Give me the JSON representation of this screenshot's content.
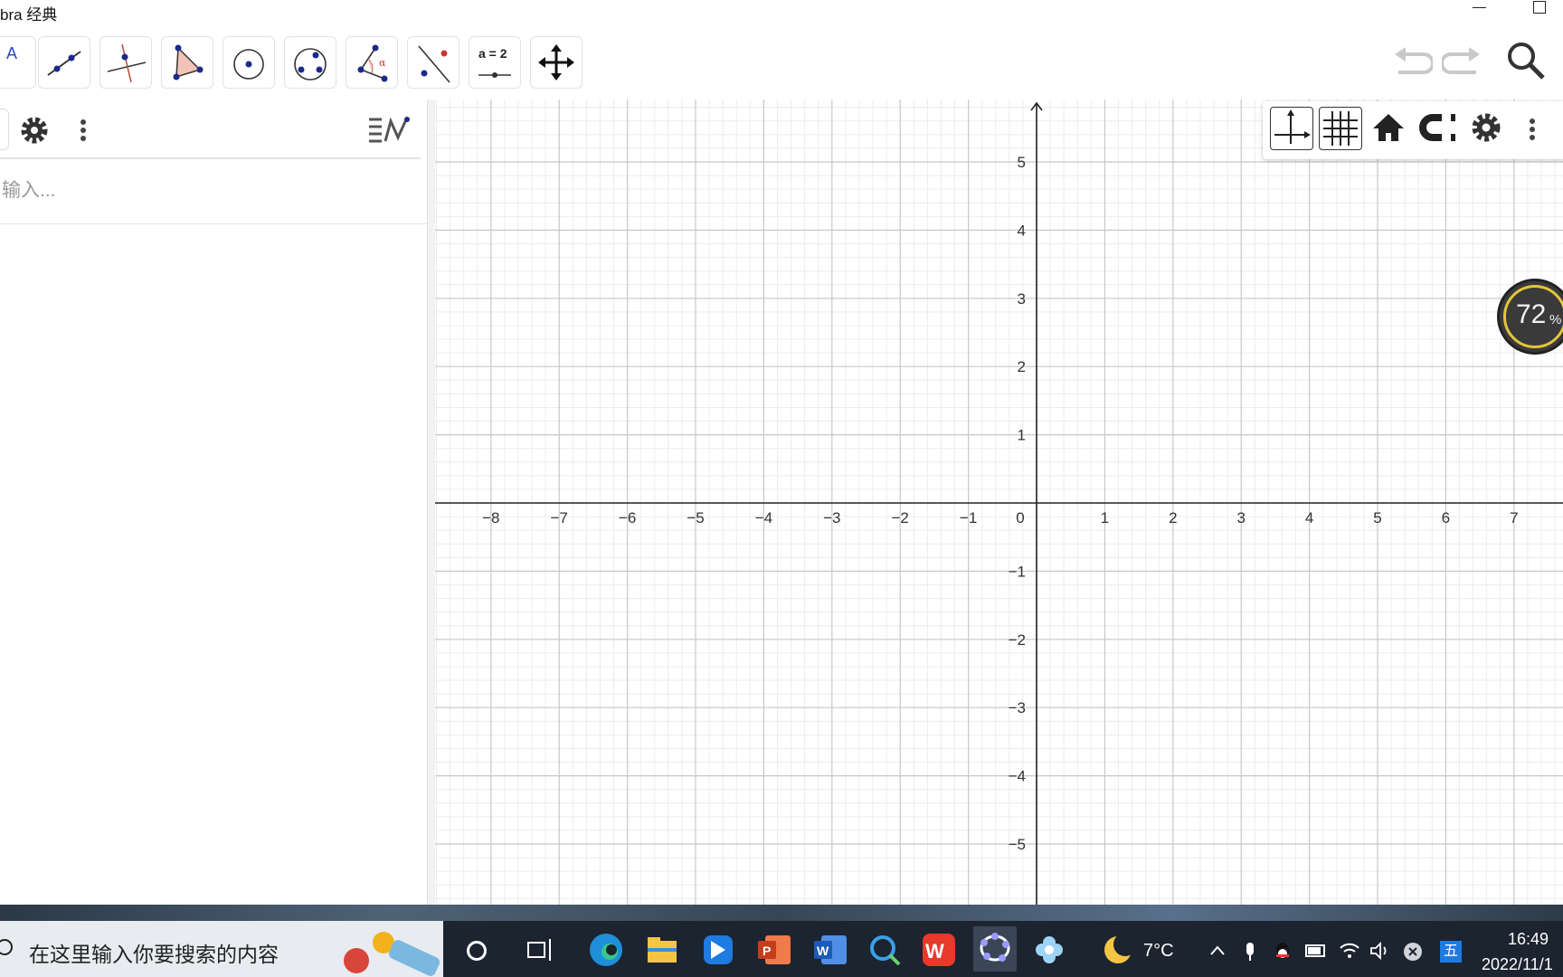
{
  "window": {
    "title": "bra 经典"
  },
  "toolbar": {
    "tools": [
      "move-tool",
      "point-tool",
      "line-tool",
      "perpendicular-tool",
      "polygon-tool",
      "circle-tool",
      "conic-tool",
      "angle-tool",
      "reflect-tool",
      "slider-tool",
      "move-graphics-tool"
    ],
    "slider_label": "a = 2",
    "text_tool_label": "A"
  },
  "algebra": {
    "input_placeholder": "输入..."
  },
  "graphics": {
    "x_ticks": [
      "−8",
      "−7",
      "−6",
      "−5",
      "−4",
      "−3",
      "−2",
      "−1",
      "0",
      "1",
      "2",
      "3",
      "4",
      "5",
      "6",
      "7"
    ],
    "y_ticks_pos": [
      "5",
      "4",
      "3",
      "2",
      "1"
    ],
    "y_ticks_neg": [
      "−1",
      "−2",
      "−3",
      "−4",
      "−5"
    ],
    "x_range": [
      -8.8,
      7.7
    ],
    "y_range": [
      -5.9,
      5.9
    ],
    "grid": "on"
  },
  "gauge": {
    "value": "72",
    "unit": "%"
  },
  "taskbar": {
    "search_placeholder": "在这里输入你要搜索的内容",
    "weather": "7°C",
    "time": "16:49",
    "date": "2022/11/1",
    "ime": "五"
  }
}
